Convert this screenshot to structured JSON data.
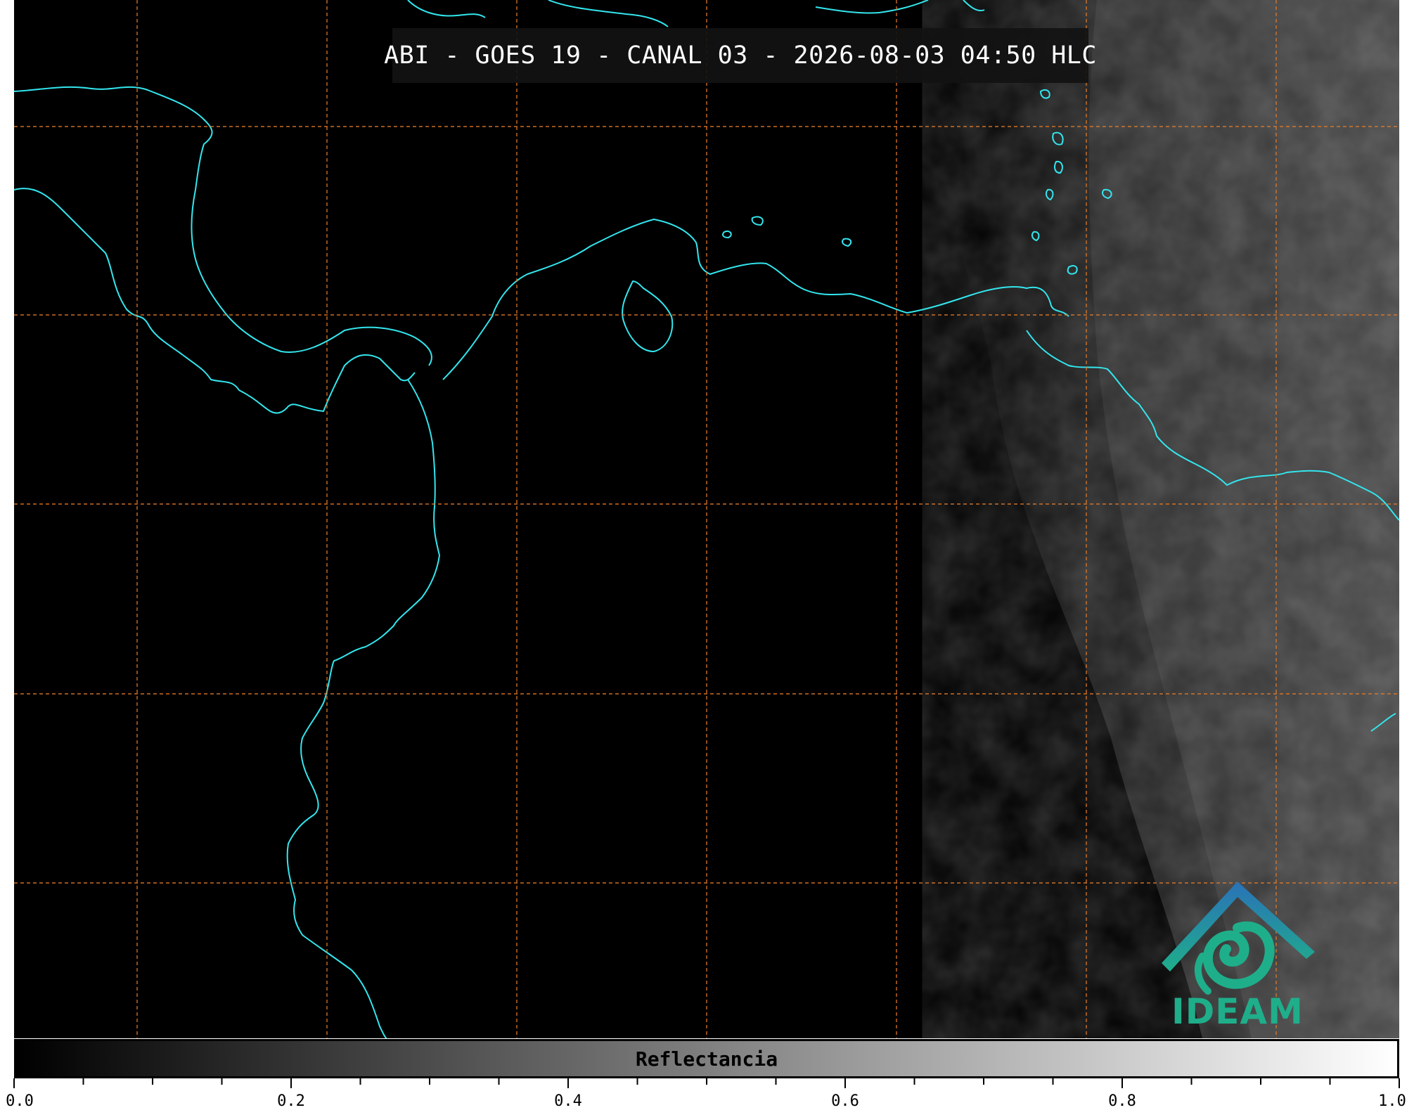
{
  "title": "ABI - GOES 19 - CANAL 03 - 2026-08-03 04:50 HLC",
  "logo": {
    "text": "IDEAM",
    "icon": "ideam-logo-icon",
    "colors": [
      "#2a72b8",
      "#1fae8a",
      "#33b56a"
    ]
  },
  "colorbar": {
    "label": "Reflectancia",
    "range": [
      0.0,
      1.0
    ],
    "ticks": [
      "0.0",
      "0.2",
      "0.4",
      "0.6",
      "0.8",
      "1.0"
    ],
    "colormap": [
      "#000000",
      "#ffffff"
    ]
  },
  "map_style": {
    "coastline_color": "#33e6ee",
    "gridline_color": "#e07a2a",
    "gridline_style": "dashed",
    "background": "#000000"
  }
}
